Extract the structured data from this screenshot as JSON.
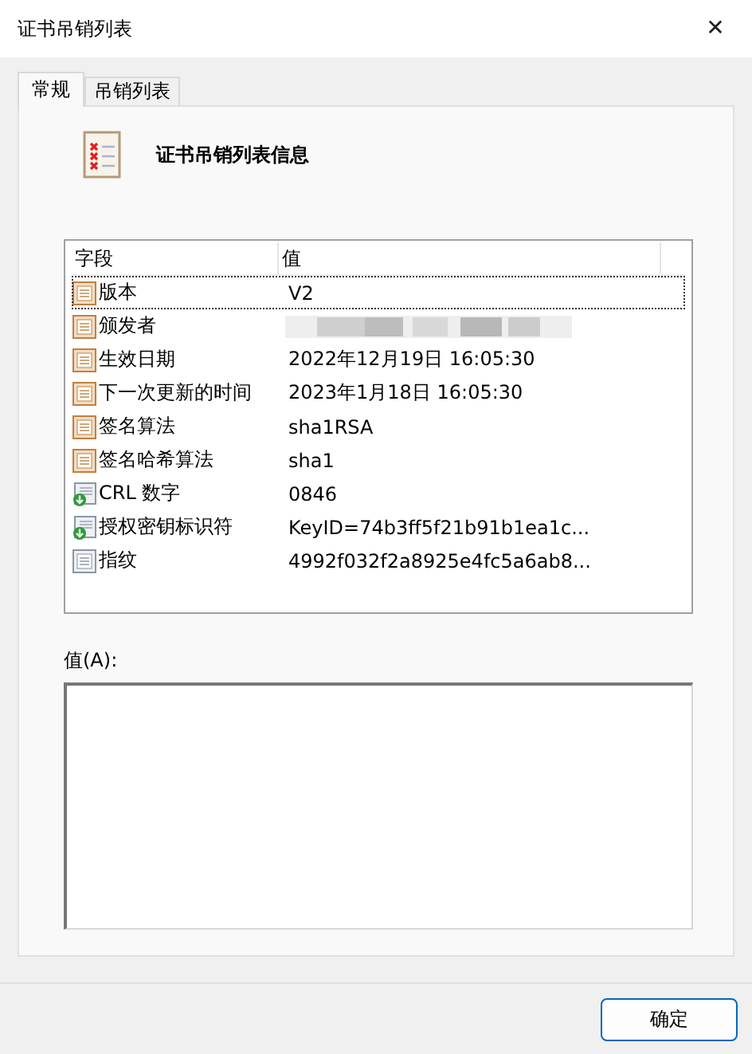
{
  "window": {
    "title": "证书吊销列表",
    "close": "✕"
  },
  "tabs": [
    {
      "label": "常规",
      "selected": true
    },
    {
      "label": "吊销列表",
      "selected": false
    }
  ],
  "header": {
    "title": "证书吊销列表信息"
  },
  "table": {
    "columns": [
      "字段",
      "值"
    ],
    "rows": [
      {
        "kind": "field",
        "field": "版本",
        "value": "V2",
        "selected": true
      },
      {
        "kind": "field",
        "field": "颁发者",
        "selected": false
      },
      {
        "kind": "field",
        "field": "生效日期",
        "value": "2022年12月19日 16:05:30",
        "selected": false
      },
      {
        "kind": "field",
        "field": "下一次更新的时间",
        "value": "2023年1月18日 16:05:30",
        "selected": false
      },
      {
        "kind": "field",
        "field": "签名算法",
        "value": "sha1RSA",
        "selected": false
      },
      {
        "kind": "field",
        "field": "签名哈希算法",
        "value": "sha1",
        "selected": false
      },
      {
        "kind": "extension",
        "field": "CRL 数字",
        "value": "0846",
        "selected": false
      },
      {
        "kind": "extension",
        "field": "授权密钥标识符",
        "value": "KeyID=74b3ff5f21b91b1ea1c...",
        "selected": false
      },
      {
        "kind": "property",
        "field": "指纹",
        "value": "4992f032f2a8925e4fc5a6ab8...",
        "selected": false
      }
    ]
  },
  "value_label": "值(A):",
  "buttons": [
    "确定"
  ]
}
